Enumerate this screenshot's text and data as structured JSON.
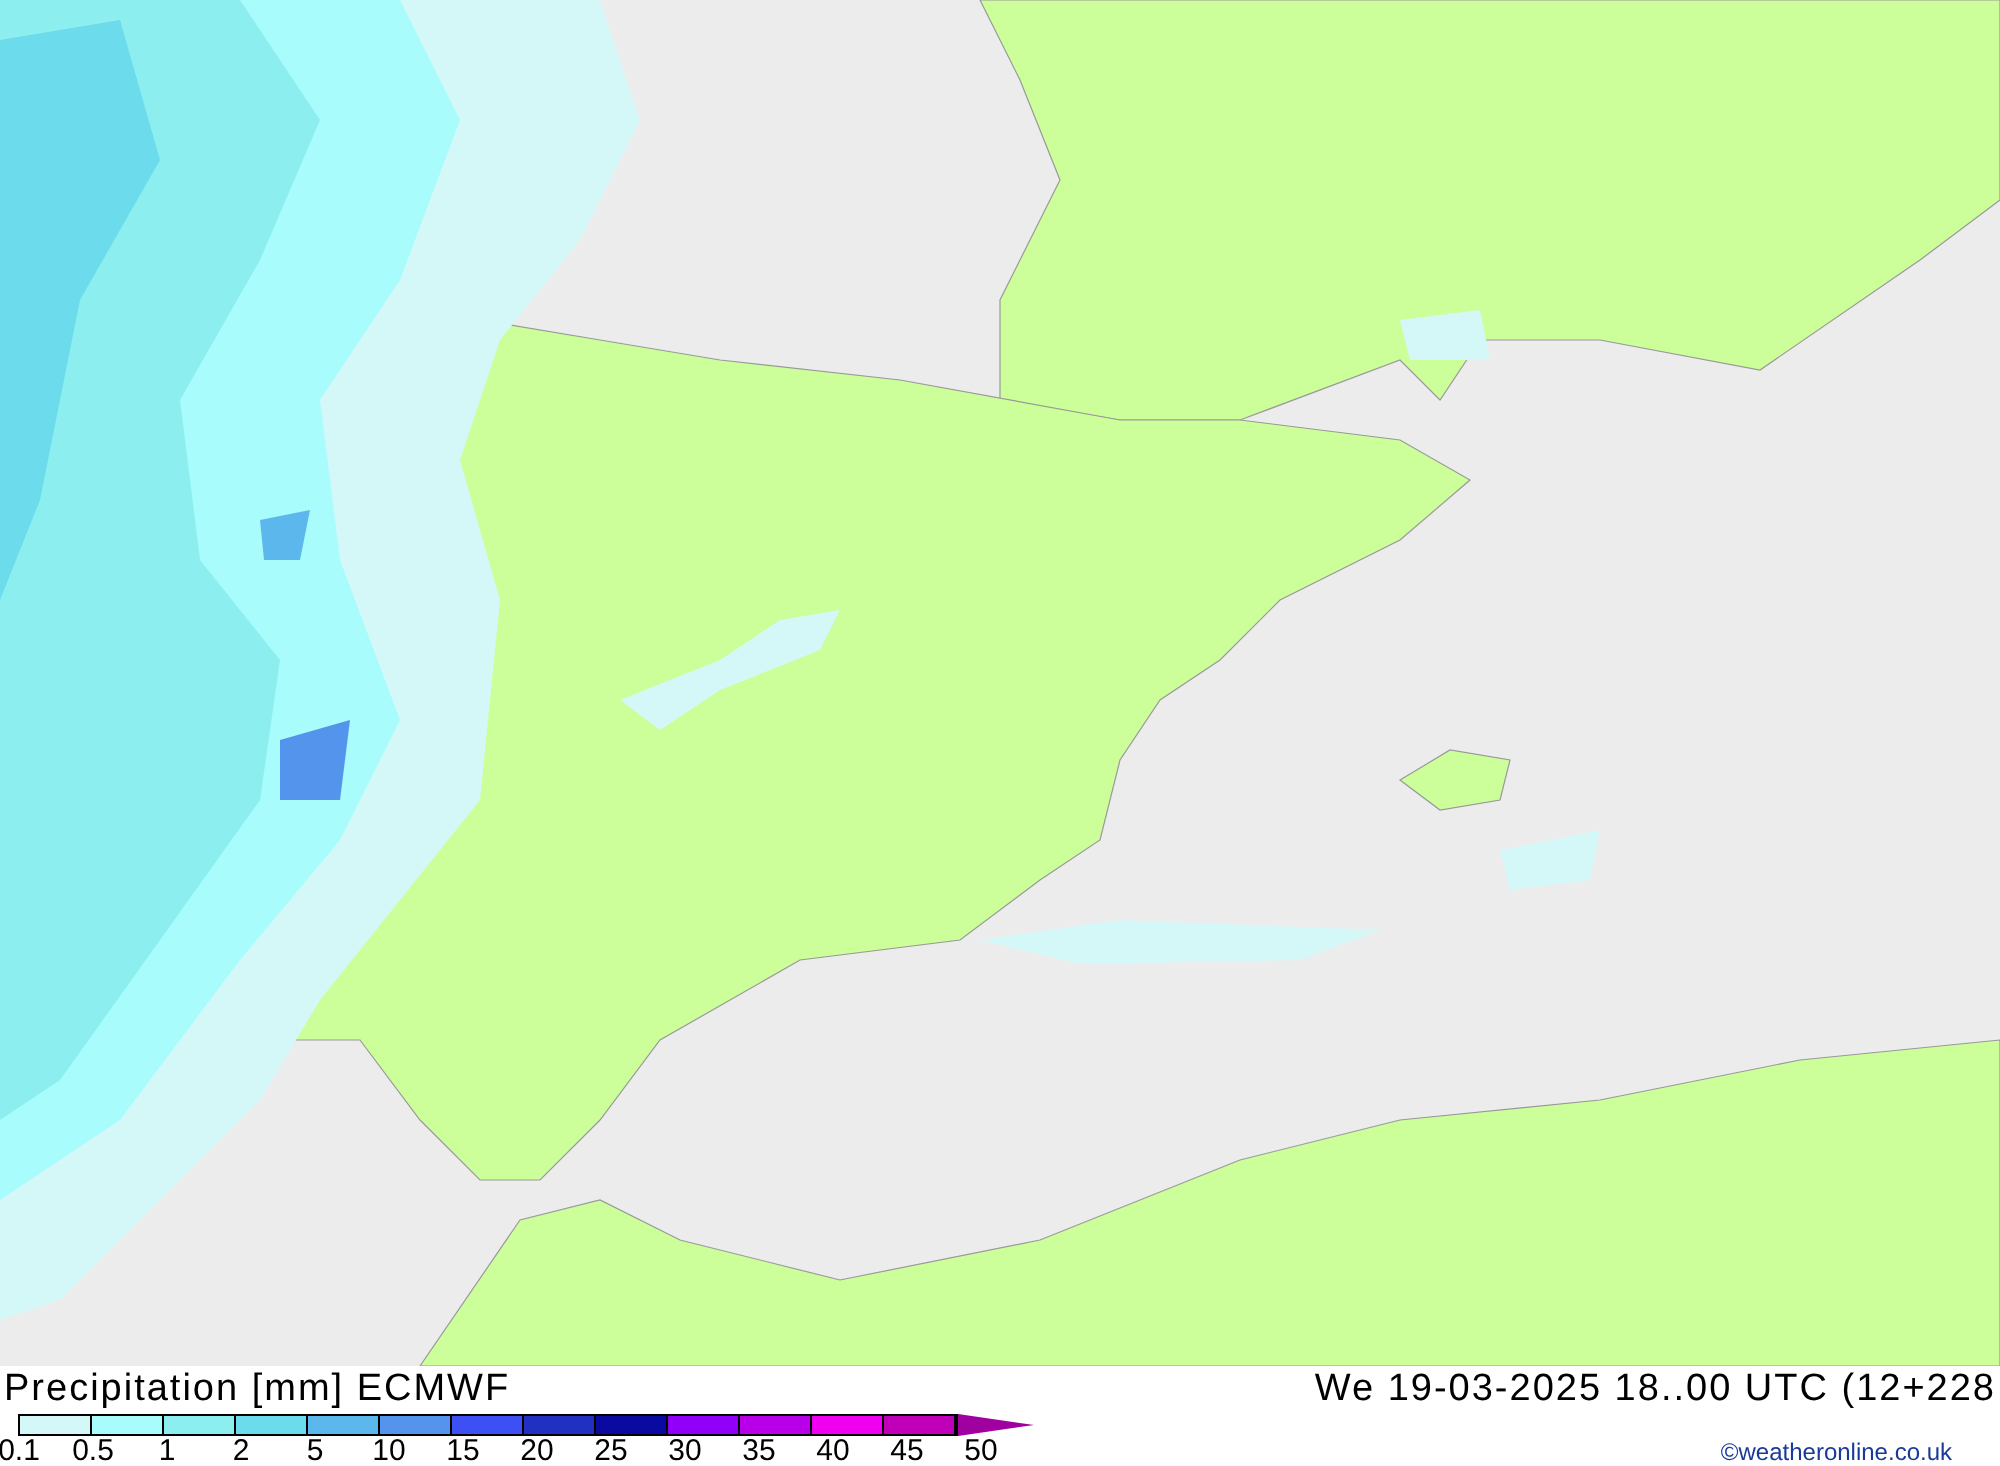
{
  "title": "Precipitation [mm] ECMWF",
  "valid_time": "We 19-03-2025 18..00 UTC (12+228",
  "legend": {
    "classes": [
      {
        "color": "#d4f8f8"
      },
      {
        "color": "#a8fcfc"
      },
      {
        "color": "#8ceeee"
      },
      {
        "color": "#6cdcec"
      },
      {
        "color": "#5cb8ec"
      },
      {
        "color": "#5494ec"
      },
      {
        "color": "#3c50f4"
      },
      {
        "color": "#2030c0"
      },
      {
        "color": "#0a0aa0"
      },
      {
        "color": "#9000f8"
      },
      {
        "color": "#b800e8"
      },
      {
        "color": "#f000f0"
      },
      {
        "color": "#c000b8"
      }
    ],
    "labels": [
      "0.1",
      "0.5",
      "1",
      "2",
      "5",
      "10",
      "15",
      "20",
      "25",
      "30",
      "35",
      "40",
      "45",
      "50"
    ]
  },
  "credit": "©weatheronline.co.uk"
}
